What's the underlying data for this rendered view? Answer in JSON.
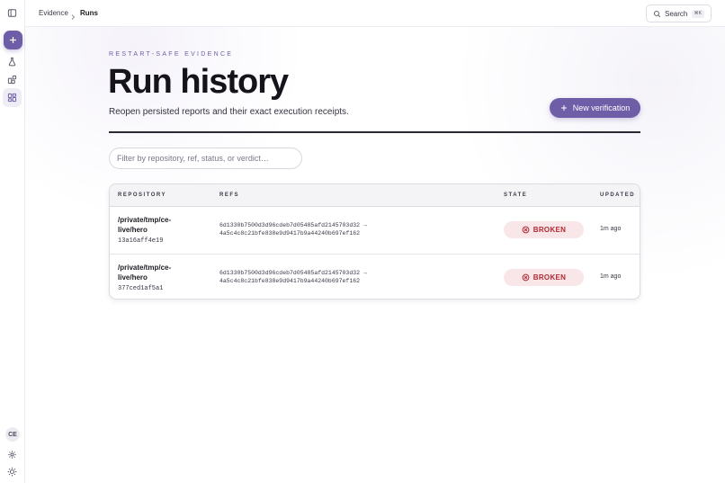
{
  "topbar": {
    "breadcrumbs": [
      "Evidence",
      "Runs"
    ],
    "search_label": "Search",
    "search_shortcut": "⌘K"
  },
  "sidebar": {
    "icons": [
      "sidebar-toggle-icon",
      "plus-icon",
      "flask-icon",
      "blocks-icon",
      "grid-icon",
      "gear-icon",
      "sun-icon"
    ],
    "avatar_initials": "CE"
  },
  "main": {
    "eyebrow": "RESTART-SAFE EVIDENCE",
    "title": "Run history",
    "subtitle": "Reopen persisted reports and their exact execution receipts.",
    "new_button_label": "New verification",
    "filter_placeholder": "Filter by repository, ref, status, or verdict…"
  },
  "table": {
    "columns": [
      "REPOSITORY",
      "REFS",
      "STATE",
      "UPDATED"
    ],
    "rows": [
      {
        "repo_line1": "/private/tmp/ce-",
        "repo_line2": "live/hero",
        "hash": "13a16aff4e19",
        "ref_line1": "6d1330b7500d3d96cdeb7d05485afd2145703d32 →",
        "ref_line2": "4a5c4c8c21bfe838e9d9417b9a44240b697ef162",
        "state": "BROKEN",
        "updated": "1m ago"
      },
      {
        "repo_line1": "/private/tmp/ce-",
        "repo_line2": "live/hero",
        "hash": "377ced1af5a1",
        "ref_line1": "6d1330b7500d3d96cdeb7d05485afd2145703d32 →",
        "ref_line2": "4a5c4c8c21bfe838e9d9417b9a44240b697ef162",
        "state": "BROKEN",
        "updated": "1m ago"
      }
    ]
  },
  "colors": {
    "accent": "#6e5ea7",
    "broken_bg": "#f9e6e8",
    "broken_text": "#b32933"
  }
}
